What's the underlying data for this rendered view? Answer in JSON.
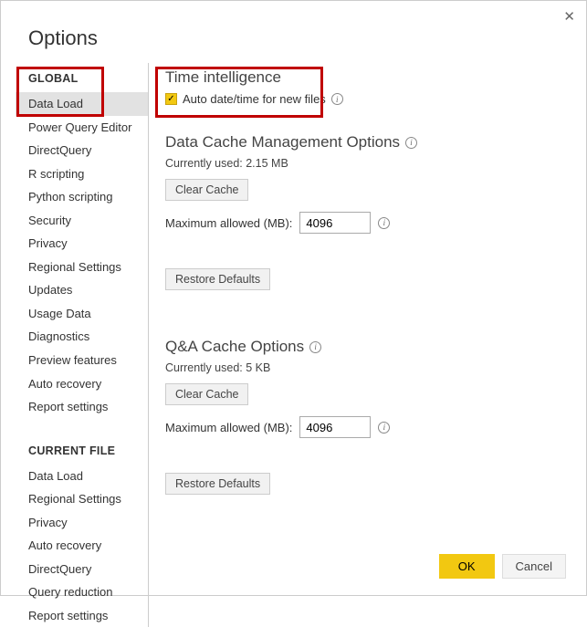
{
  "dialog": {
    "title": "Options",
    "close_glyph": "✕"
  },
  "sidebar": {
    "global_header": "GLOBAL",
    "global_items": [
      "Data Load",
      "Power Query Editor",
      "DirectQuery",
      "R scripting",
      "Python scripting",
      "Security",
      "Privacy",
      "Regional Settings",
      "Updates",
      "Usage Data",
      "Diagnostics",
      "Preview features",
      "Auto recovery",
      "Report settings"
    ],
    "current_header": "CURRENT FILE",
    "current_items": [
      "Data Load",
      "Regional Settings",
      "Privacy",
      "Auto recovery",
      "DirectQuery",
      "Query reduction",
      "Report settings"
    ],
    "selected": "Data Load"
  },
  "main": {
    "time_intelligence": {
      "title": "Time intelligence",
      "auto_dt_label": "Auto date/time for new files",
      "auto_dt_checked": true
    },
    "data_cache": {
      "title": "Data Cache Management Options",
      "currently_used_label": "Currently used: 2.15 MB",
      "clear_cache": "Clear Cache",
      "max_label": "Maximum allowed (MB):",
      "max_value": "4096",
      "restore": "Restore Defaults"
    },
    "qa_cache": {
      "title": "Q&A Cache Options",
      "currently_used_label": "Currently used: 5 KB",
      "clear_cache": "Clear Cache",
      "max_label": "Maximum allowed (MB):",
      "max_value": "4096",
      "restore": "Restore Defaults"
    }
  },
  "footer": {
    "ok": "OK",
    "cancel": "Cancel"
  },
  "info_glyph": "i",
  "check_glyph": "✓"
}
